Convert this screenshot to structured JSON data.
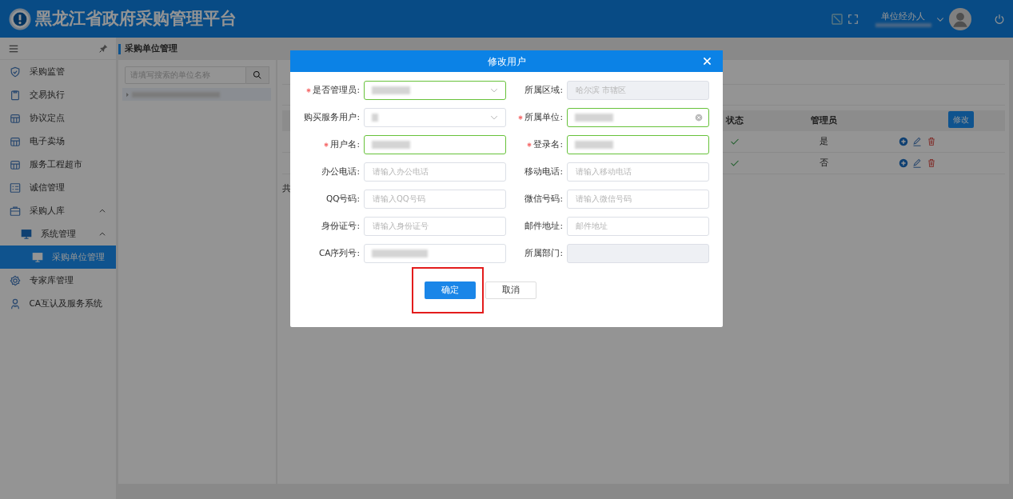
{
  "header": {
    "title": "黑龙江省政府采购管理平台",
    "user_role": "单位经办人"
  },
  "sidebar": {
    "items": [
      {
        "label": "采购监管",
        "selected": false
      },
      {
        "label": "交易执行",
        "selected": false
      },
      {
        "label": "协议定点",
        "selected": false
      },
      {
        "label": "电子卖场",
        "selected": false
      },
      {
        "label": "服务工程超市",
        "selected": false
      },
      {
        "label": "诚信管理",
        "selected": false
      },
      {
        "label": "采购人库",
        "selected": false,
        "expanded": true,
        "children": [
          {
            "label": "系统管理",
            "selected": false,
            "expanded": true,
            "children": [
              {
                "label": "采购单位管理",
                "selected": true
              }
            ]
          }
        ]
      },
      {
        "label": "专家库管理",
        "selected": false
      },
      {
        "label": "CA互认及服务系统",
        "selected": false
      }
    ]
  },
  "breadcrumb": "采购单位管理",
  "tree": {
    "search_placeholder": "请填写搜索的单位名称"
  },
  "table": {
    "columns": [
      "状态",
      "管理员"
    ],
    "rows": [
      {
        "active": true,
        "admin": "是"
      },
      {
        "active": true,
        "admin": "否"
      }
    ],
    "tooltip": "修改",
    "footer": "共"
  },
  "dialog": {
    "title": "修改用户",
    "fields": [
      {
        "label": "是否管理员:",
        "required": true,
        "kind": "select",
        "redacted": true,
        "valid": true
      },
      {
        "label": "所属区域:",
        "required": false,
        "kind": "input",
        "placeholder": "哈尔滨 市辖区",
        "disabled": true
      },
      {
        "label": "购买服务用户:",
        "required": false,
        "kind": "select",
        "redacted": true
      },
      {
        "label": "所属单位:",
        "required": true,
        "kind": "input",
        "redacted": true,
        "valid": true,
        "clearable": true
      },
      {
        "label": "用户名:",
        "required": true,
        "kind": "input",
        "redacted": true,
        "valid": true
      },
      {
        "label": "登录名:",
        "required": true,
        "kind": "input",
        "redacted": true,
        "valid": true
      },
      {
        "label": "办公电话:",
        "required": false,
        "kind": "input",
        "placeholder": "请输入办公电话"
      },
      {
        "label": "移动电话:",
        "required": false,
        "kind": "input",
        "placeholder": "请输入移动电话"
      },
      {
        "label": "QQ号码:",
        "required": false,
        "kind": "input",
        "placeholder": "请输入QQ号码"
      },
      {
        "label": "微信号码:",
        "required": false,
        "kind": "input",
        "placeholder": "请输入微信号码"
      },
      {
        "label": "身份证号:",
        "required": false,
        "kind": "input",
        "placeholder": "请输入身份证号"
      },
      {
        "label": "邮件地址:",
        "required": false,
        "kind": "input",
        "placeholder": "邮件地址"
      },
      {
        "label": "CA序列号:",
        "required": false,
        "kind": "input",
        "redacted": true
      },
      {
        "label": "所属部门:",
        "required": false,
        "kind": "input",
        "disabled": true
      }
    ],
    "buttons": [
      {
        "label": "确定",
        "kind": "primary",
        "highlighted": true
      },
      {
        "label": "取消",
        "kind": "default",
        "highlighted": false
      }
    ]
  }
}
